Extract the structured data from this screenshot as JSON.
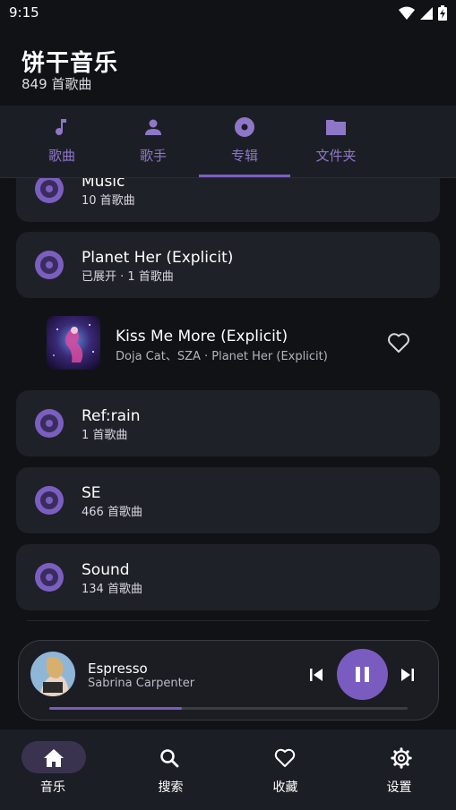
{
  "status_bar": {
    "time": "9:15"
  },
  "header": {
    "title": "饼干音乐",
    "subtitle": "849 首歌曲"
  },
  "tabs": [
    {
      "label": "歌曲",
      "icon": "music-note-icon"
    },
    {
      "label": "歌手",
      "icon": "person-icon"
    },
    {
      "label": "专辑",
      "icon": "album-icon",
      "selected": true
    },
    {
      "label": "文件夹",
      "icon": "folder-icon"
    }
  ],
  "albums": [
    {
      "title": "Music",
      "subtitle": "10 首歌曲"
    },
    {
      "title": "Planet Her (Explicit)",
      "subtitle": "已展开 · 1 首歌曲"
    },
    {
      "title": "Ref:rain",
      "subtitle": "1 首歌曲"
    },
    {
      "title": "SE",
      "subtitle": "466 首歌曲"
    },
    {
      "title": "Sound",
      "subtitle": "134 首歌曲"
    }
  ],
  "expanded_song": {
    "title": "Kiss Me More (Explicit)",
    "subtitle": "Doja Cat、SZA · Planet Her (Explicit)"
  },
  "now_playing": {
    "title": "Espresso",
    "artist": "Sabrina Carpenter",
    "progress": 0.37
  },
  "bottom_nav": [
    {
      "label": "音乐",
      "icon": "home-icon",
      "selected": true
    },
    {
      "label": "搜索",
      "icon": "search-icon"
    },
    {
      "label": "收藏",
      "icon": "heart-icon"
    },
    {
      "label": "设置",
      "icon": "gear-icon"
    }
  ],
  "colors": {
    "accent": "#7a5cc0",
    "background": "#111216",
    "card": "#1f2128"
  }
}
